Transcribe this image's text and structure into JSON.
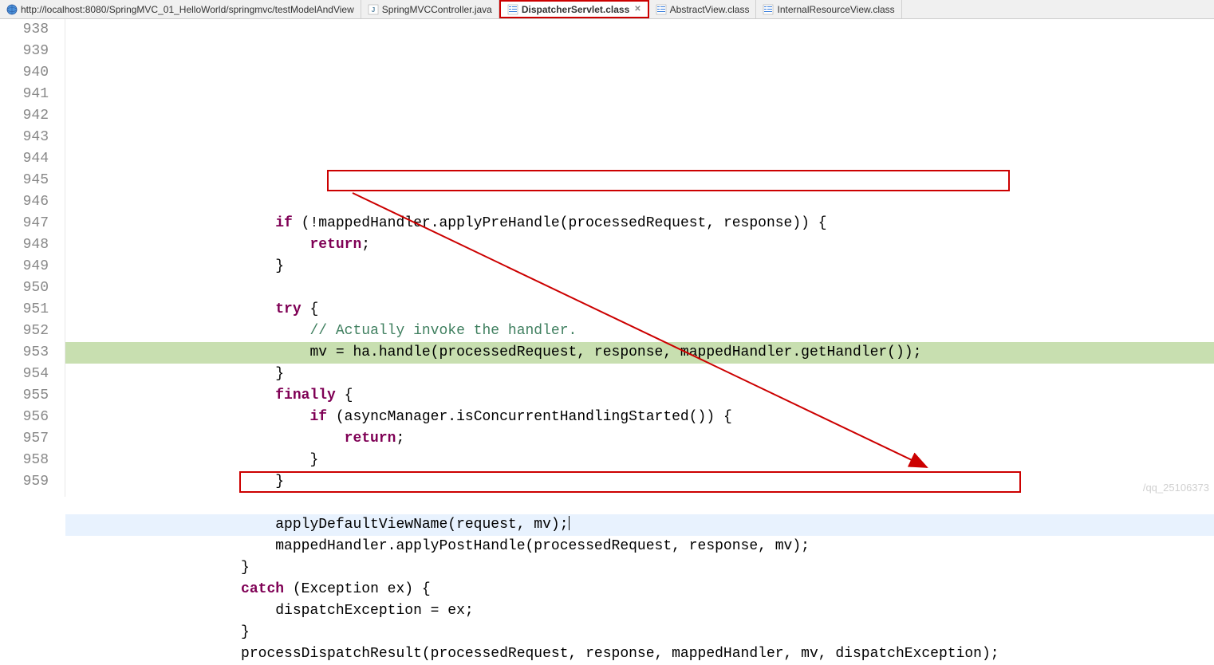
{
  "tabs": [
    {
      "label": "http://localhost:8080/SpringMVC_01_HelloWorld/springmvc/testModelAndView",
      "icon": "browser-icon",
      "active": false
    },
    {
      "label": "SpringMVCController.java",
      "icon": "java-file-icon",
      "active": false
    },
    {
      "label": "DispatcherServlet.class",
      "icon": "class-file-icon",
      "active": true
    },
    {
      "label": "AbstractView.class",
      "icon": "class-file-icon",
      "active": false
    },
    {
      "label": "InternalResourceView.class",
      "icon": "class-file-icon",
      "active": false
    }
  ],
  "lineStart": 938,
  "lines": [
    {
      "n": 938,
      "indent": "",
      "tokens": []
    },
    {
      "n": 939,
      "indent": "                        ",
      "tokens": [
        {
          "t": "kw",
          "v": "if"
        },
        {
          "t": "p",
          "v": " (!mappedHandler.applyPreHandle(processedRequest, response)) {"
        }
      ]
    },
    {
      "n": 940,
      "indent": "                            ",
      "tokens": [
        {
          "t": "kw",
          "v": "return"
        },
        {
          "t": "p",
          "v": ";"
        }
      ]
    },
    {
      "n": 941,
      "indent": "                        ",
      "tokens": [
        {
          "t": "p",
          "v": "}"
        }
      ]
    },
    {
      "n": 942,
      "indent": "",
      "tokens": []
    },
    {
      "n": 943,
      "indent": "                        ",
      "tokens": [
        {
          "t": "kw",
          "v": "try"
        },
        {
          "t": "p",
          "v": " {"
        }
      ]
    },
    {
      "n": 944,
      "indent": "                            ",
      "tokens": [
        {
          "t": "comment",
          "v": "// Actually invoke the handler."
        }
      ]
    },
    {
      "n": 945,
      "indent": "                            ",
      "hl": "green",
      "tokens": [
        {
          "t": "p",
          "v": "mv = ha.handle(processedRequest, response, mappedHandler.getHandler());"
        }
      ]
    },
    {
      "n": 946,
      "indent": "                        ",
      "tokens": [
        {
          "t": "p",
          "v": "}"
        }
      ]
    },
    {
      "n": 947,
      "indent": "                        ",
      "tokens": [
        {
          "t": "kw",
          "v": "finally"
        },
        {
          "t": "p",
          "v": " {"
        }
      ]
    },
    {
      "n": 948,
      "indent": "                            ",
      "tokens": [
        {
          "t": "kw",
          "v": "if"
        },
        {
          "t": "p",
          "v": " (asyncManager.isConcurrentHandlingStarted()) {"
        }
      ]
    },
    {
      "n": 949,
      "indent": "                                ",
      "tokens": [
        {
          "t": "kw",
          "v": "return"
        },
        {
          "t": "p",
          "v": ";"
        }
      ]
    },
    {
      "n": 950,
      "indent": "                            ",
      "tokens": [
        {
          "t": "p",
          "v": "}"
        }
      ]
    },
    {
      "n": 951,
      "indent": "                        ",
      "tokens": [
        {
          "t": "p",
          "v": "}"
        }
      ]
    },
    {
      "n": 952,
      "indent": "",
      "tokens": []
    },
    {
      "n": 953,
      "indent": "                        ",
      "hl": "blue",
      "cursor": true,
      "tokens": [
        {
          "t": "p",
          "v": "applyDefaultViewName(request, mv);"
        }
      ]
    },
    {
      "n": 954,
      "indent": "                        ",
      "tokens": [
        {
          "t": "p",
          "v": "mappedHandler.applyPostHandle(processedRequest, response, mv);"
        }
      ]
    },
    {
      "n": 955,
      "indent": "                    ",
      "tokens": [
        {
          "t": "p",
          "v": "}"
        }
      ]
    },
    {
      "n": 956,
      "indent": "                    ",
      "tokens": [
        {
          "t": "kw",
          "v": "catch"
        },
        {
          "t": "p",
          "v": " (Exception ex) {"
        }
      ]
    },
    {
      "n": 957,
      "indent": "                        ",
      "tokens": [
        {
          "t": "p",
          "v": "dispatchException = ex;"
        }
      ]
    },
    {
      "n": 958,
      "indent": "                    ",
      "tokens": [
        {
          "t": "p",
          "v": "}"
        }
      ]
    },
    {
      "n": 959,
      "indent": "                    ",
      "tokens": [
        {
          "t": "p",
          "v": "processDispatchResult(processedRequest, response, mappedHandler, mv, dispatchException);"
        }
      ]
    }
  ],
  "watermark": "/qq_25106373",
  "closeGlyph": "✕"
}
